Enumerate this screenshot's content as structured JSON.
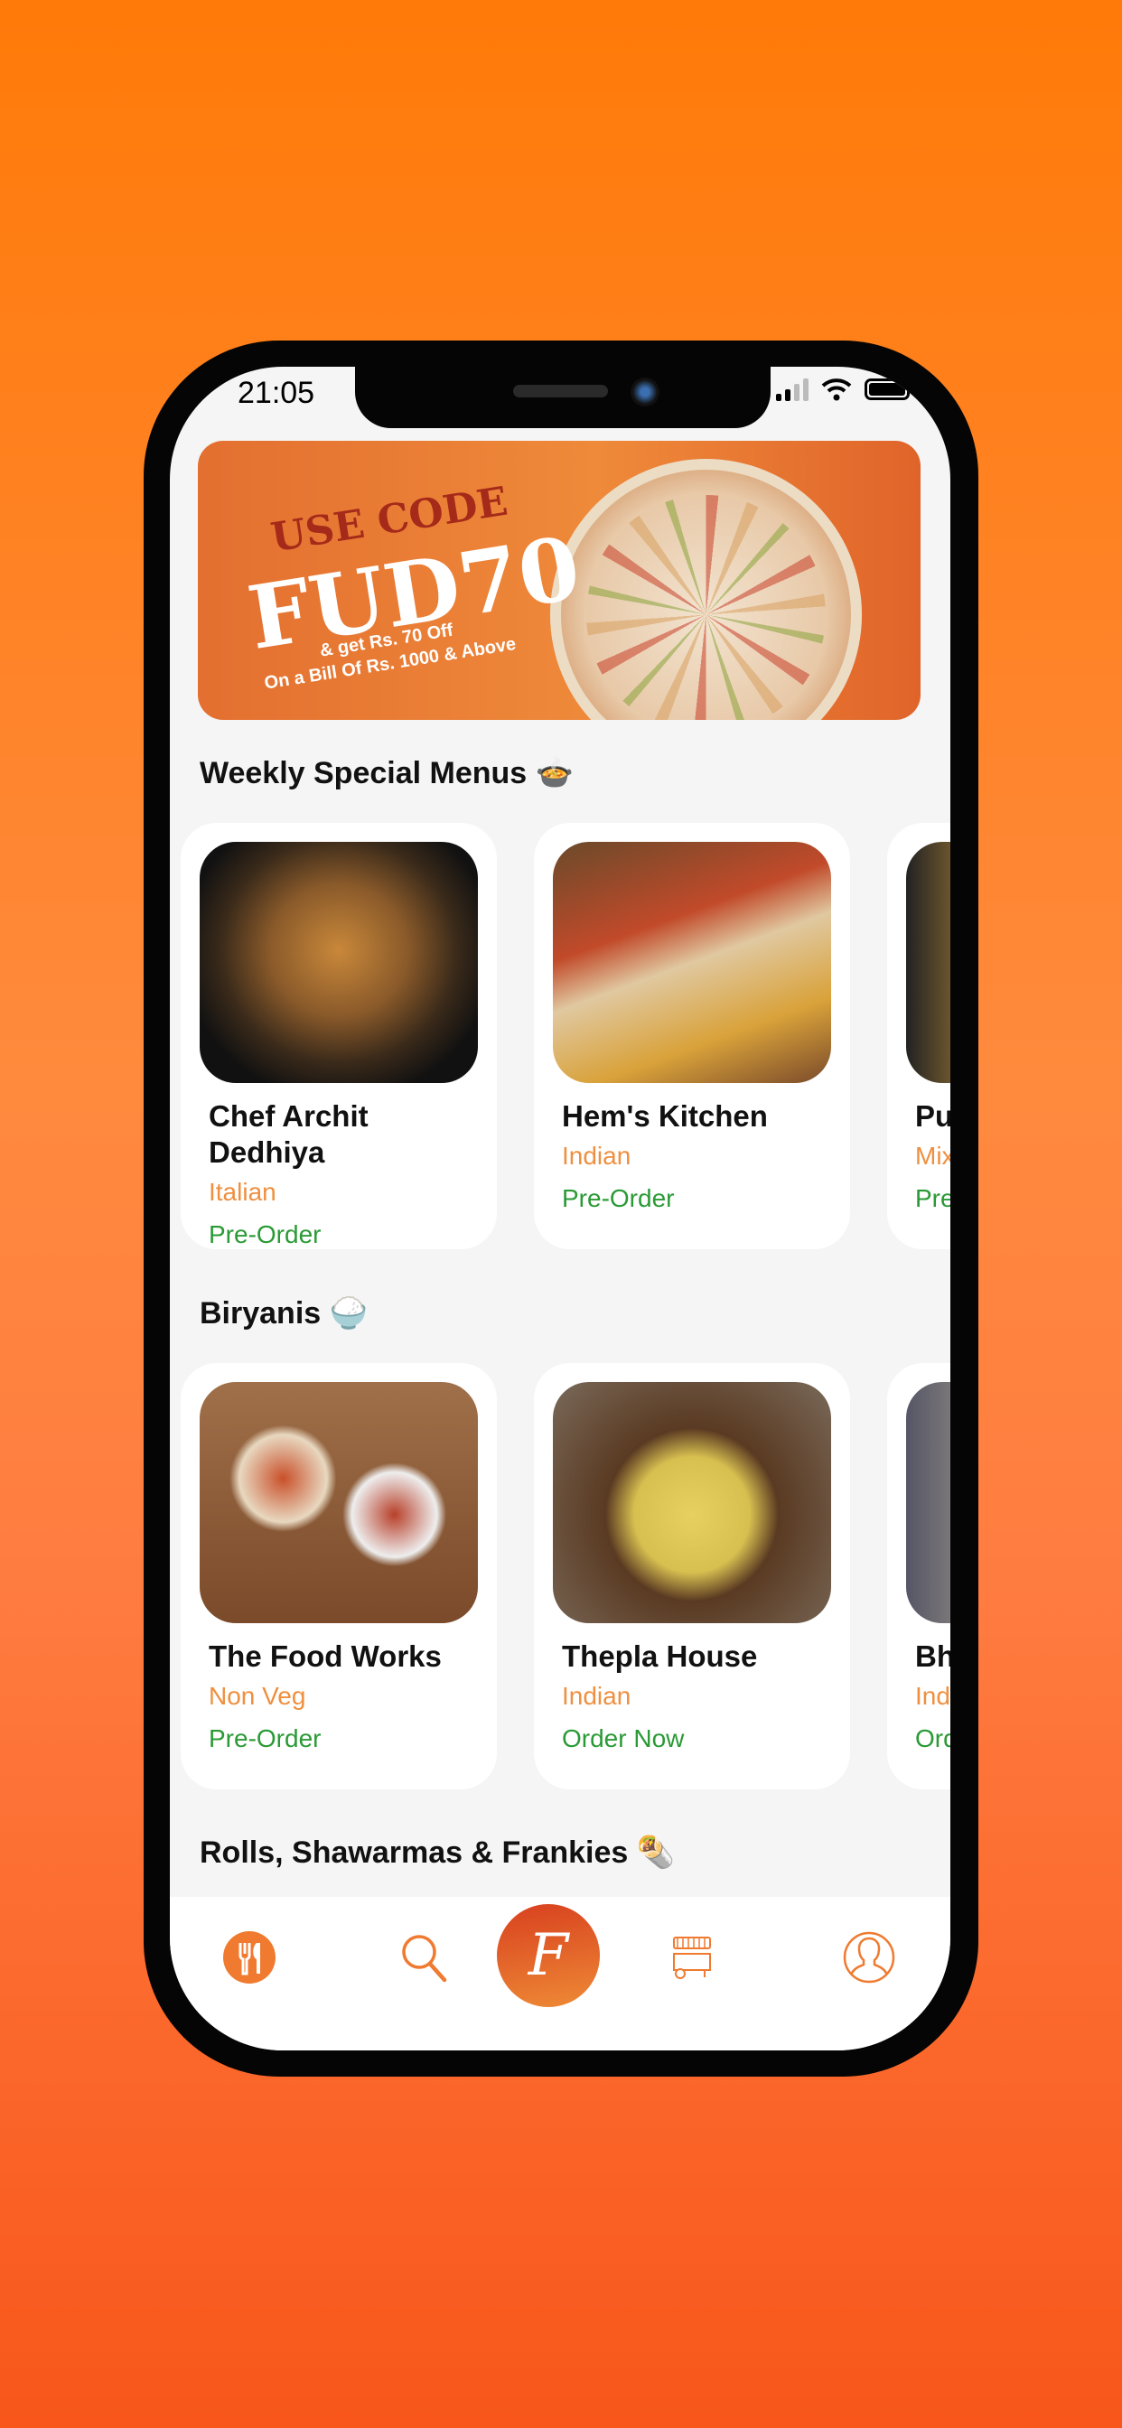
{
  "status_bar": {
    "time": "21:05"
  },
  "banner": {
    "line1": "USE CODE",
    "code": "FUD70",
    "offer1": "& get Rs. 70 Off",
    "offer2": "On a Bill Of Rs. 1000 & Above"
  },
  "sections": [
    {
      "title": "Weekly Special Menus 🍲",
      "cards": [
        {
          "name": "Chef Archit Dedhiya",
          "cuisine": "Italian",
          "status": "Pre-Order"
        },
        {
          "name": "Hem's Kitchen",
          "cuisine": "Indian",
          "status": "Pre-Order"
        },
        {
          "name": "Pu",
          "cuisine": "Mix",
          "status": "Pre"
        }
      ]
    },
    {
      "title": "Biryanis 🍚",
      "cards": [
        {
          "name": "The Food Works",
          "cuisine": "Non Veg",
          "status": "Pre-Order"
        },
        {
          "name": "Thepla House",
          "cuisine": "Indian",
          "status": "Order Now"
        },
        {
          "name": "Bh",
          "cuisine": "Ind",
          "status": "Ord"
        }
      ]
    },
    {
      "title": "Rolls, Shawarmas & Frankies 🌯"
    }
  ],
  "nav": {
    "items": [
      "restaurants-icon",
      "search-icon",
      "home-logo-icon",
      "food-cart-icon",
      "profile-icon"
    ],
    "logo_letter": "F"
  },
  "colors": {
    "accent": "#ef7a30",
    "green": "#2a9a35",
    "cuisine": "#ef8f3f"
  }
}
